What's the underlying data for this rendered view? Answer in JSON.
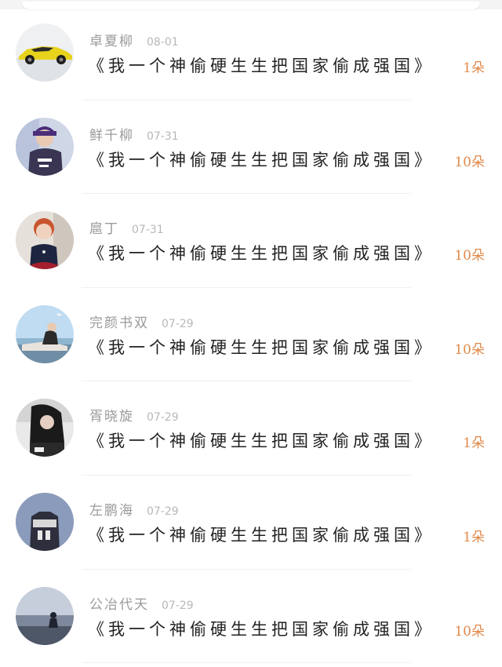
{
  "comments": [
    {
      "name": "卓夏柳",
      "date": "08-01",
      "text": "《我一个神偷硬生生把国家偷成强国》",
      "count": "1朵",
      "avatar_icon": "sports-car-avatar"
    },
    {
      "name": "鲜千柳",
      "date": "07-31",
      "text": "《我一个神偷硬生生把国家偷成强国》",
      "count": "10朵",
      "avatar_icon": "boy-in-cap-avatar"
    },
    {
      "name": "扈丁",
      "date": "07-31",
      "text": "《我一个神偷硬生生把国家偷成强国》",
      "count": "10朵",
      "avatar_icon": "girl-portrait-avatar"
    },
    {
      "name": "完颜书双",
      "date": "07-29",
      "text": "《我一个神偷硬生生把国家偷成强国》",
      "count": "10朵",
      "avatar_icon": "man-by-sea-avatar"
    },
    {
      "name": "胥晓旋",
      "date": "07-29",
      "text": "《我一个神偷硬生生把国家偷成强国》",
      "count": "1朵",
      "avatar_icon": "woman-dark-avatar"
    },
    {
      "name": "左鹏海",
      "date": "07-29",
      "text": "《我一个神偷硬生生把国家偷成强国》",
      "count": "1朵",
      "avatar_icon": "jersey-07-avatar"
    },
    {
      "name": "公冶代天",
      "date": "07-29",
      "text": "《我一个神偷硬生生把国家偷成强国》",
      "count": "10朵",
      "avatar_icon": "silhouette-dusk-avatar"
    }
  ],
  "colors": {
    "count_accent": "#e0894a",
    "name_gray": "#9a9a9a",
    "text_dark": "#222222"
  }
}
